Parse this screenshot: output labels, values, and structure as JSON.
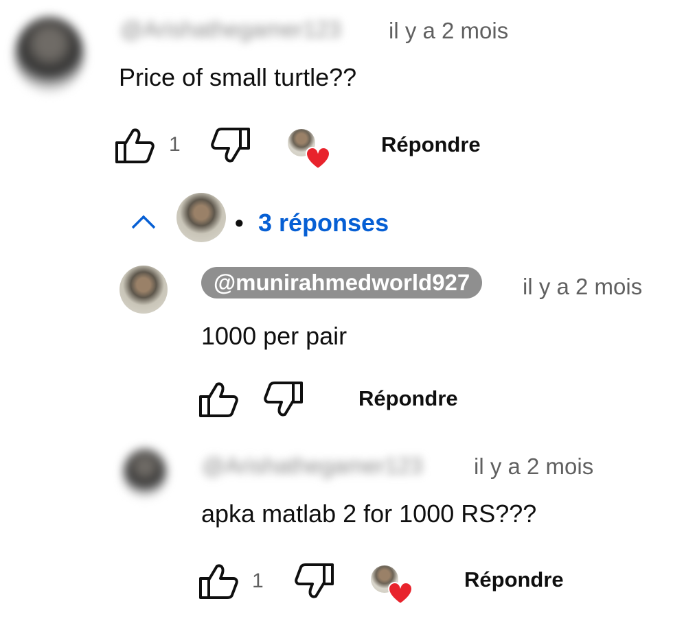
{
  "comment": {
    "author_handle": "@Arishathegamer123",
    "time": "il y a 2 mois",
    "text": "Price of small turtle??",
    "like_count": "1",
    "reply_label": "Répondre"
  },
  "replies_toggle": {
    "label": "3 réponses",
    "separator": "•"
  },
  "replies": [
    {
      "author_handle": "@munirahmedworld927",
      "time": "il y a 2 mois",
      "text": "1000 per pair",
      "reply_label": "Répondre"
    },
    {
      "author_handle": "@Arishathegamer123",
      "time": "il y a 2 mois",
      "text": "apka matlab 2 for 1000 RS???",
      "like_count": "1",
      "reply_label": "Répondre"
    }
  ],
  "icons": [
    "like-icon",
    "dislike-icon",
    "creator-heart-icon",
    "chevron-up-icon"
  ],
  "colors": {
    "link_blue": "#065fd4",
    "heart_red": "#e8232c",
    "pill_gray": "#8f8f8f"
  }
}
